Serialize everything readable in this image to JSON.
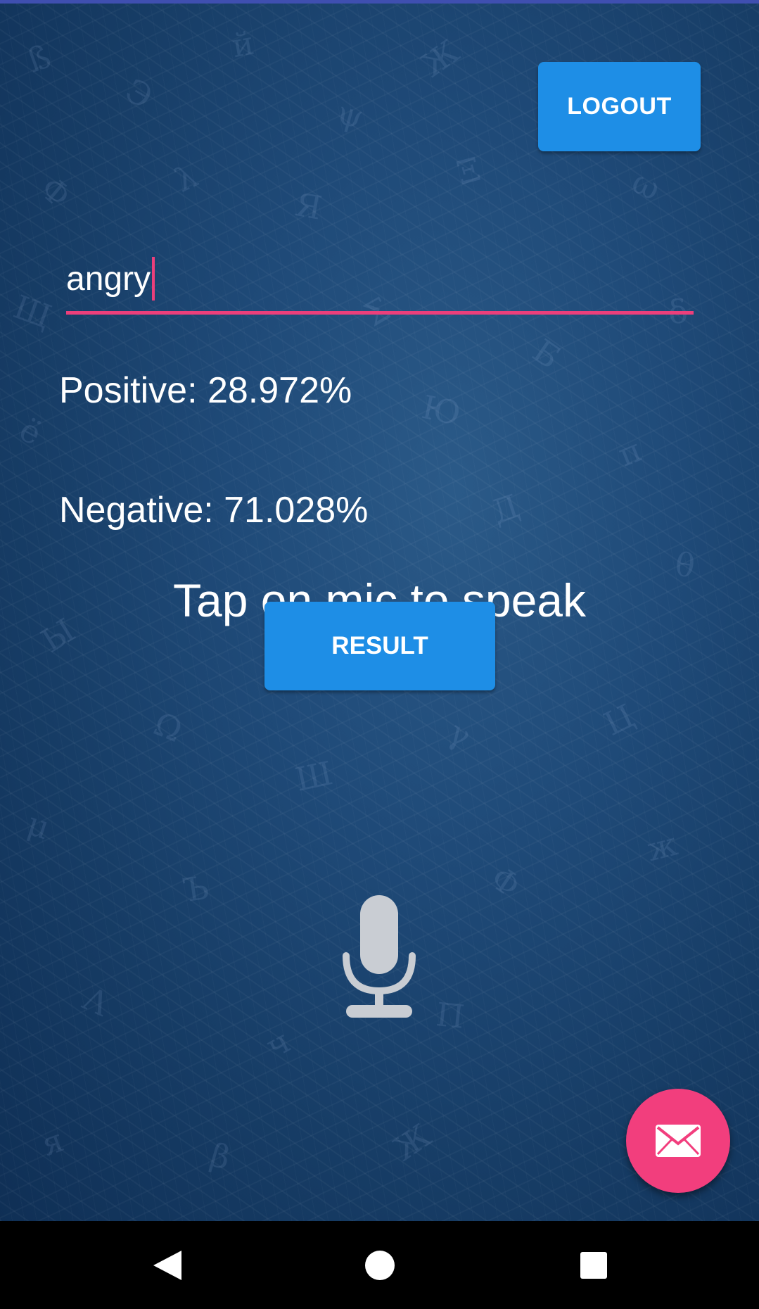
{
  "header": {
    "logout_label": "LOGOUT"
  },
  "input": {
    "value": "angry"
  },
  "sentiment": {
    "positive_text": "Positive: 28.972%",
    "negative_text": "Negative: 71.028%"
  },
  "hint_text": "Tap on mic to speak",
  "result_label": "RESULT",
  "icons": {
    "mic": "microphone-icon",
    "fab": "mail-icon",
    "nav_back": "back-triangle-icon",
    "nav_home": "home-circle-icon",
    "nav_recents": "recents-square-icon"
  },
  "colors": {
    "accent_blue": "#1e8ee6",
    "accent_pink": "#f23e7d",
    "underline": "#ec3f7b",
    "background": "#1f4a78"
  }
}
